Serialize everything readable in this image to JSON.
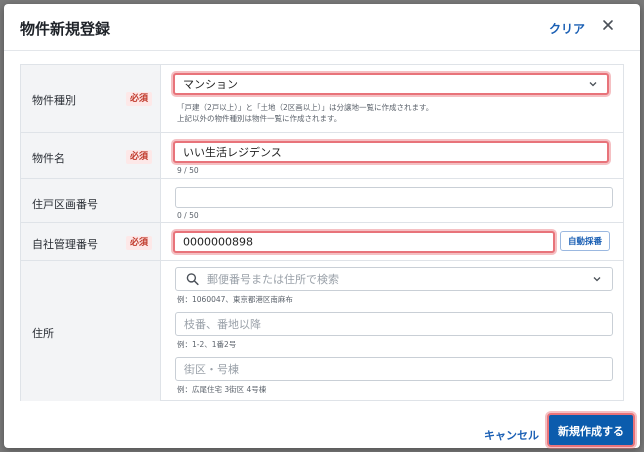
{
  "modal": {
    "title": "物件新規登録",
    "clear_label": "クリア"
  },
  "form": {
    "property_type": {
      "label": "物件種別",
      "required": "必須",
      "value": "マンション",
      "hint_line1": "「戸建（2戸以上）」と「土地（2区画以上）」は分譲地一覧に作成されます。",
      "hint_line2": "上記以外の物件種別は物件一覧に作成されます。"
    },
    "property_name": {
      "label": "物件名",
      "required": "必須",
      "value": "いい生活レジデンス",
      "count": "9 / 50"
    },
    "unit_number": {
      "label": "住戸区画番号",
      "value": "",
      "count": "0 / 50"
    },
    "company_number": {
      "label": "自社管理番号",
      "required": "必須",
      "value": "0000000898",
      "auto_button": "自動採番"
    },
    "address": {
      "label": "住所",
      "search_placeholder": "郵便番号または住所で検索",
      "search_example": "例：1060047、東京都港区南麻布",
      "lot_placeholder": "枝番、番地以降",
      "lot_example": "例：1-2、1番2号",
      "block_placeholder": "街区・号棟",
      "block_example": "例：広尾住宅 3街区 4号棟"
    }
  },
  "footer": {
    "cancel_label": "キャンセル",
    "submit_label": "新規作成する"
  },
  "colors": {
    "accent": "#1a5fb4",
    "primary_button": "#0b5cad",
    "required_badge_bg": "#fde8e8",
    "required_badge_text": "#c0392b",
    "highlight": "#e8737a"
  }
}
